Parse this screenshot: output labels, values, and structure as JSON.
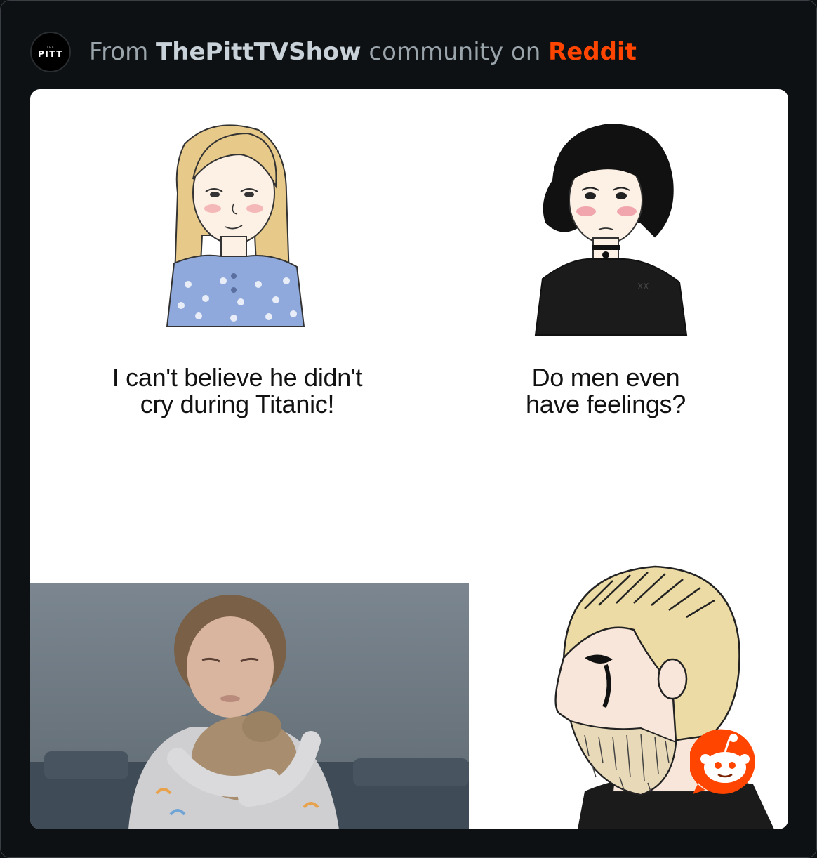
{
  "header": {
    "avatar_small_text": "THE",
    "avatar_label": "PITT",
    "prefix": "From ",
    "community": "ThePittTVShow",
    "middle": " community on ",
    "platform": "Reddit"
  },
  "meme": {
    "panel1_caption_line1": "I can't believe he didn't",
    "panel1_caption_line2": "cry during Titanic!",
    "panel2_caption_line1": "Do men even",
    "panel2_caption_line2": "have feelings?"
  },
  "colors": {
    "background": "#0e1113",
    "reddit_orange": "#ff4500",
    "card": "#ffffff"
  },
  "icons": [
    "pitt-logo-icon",
    "reddit-snoo-icon"
  ]
}
